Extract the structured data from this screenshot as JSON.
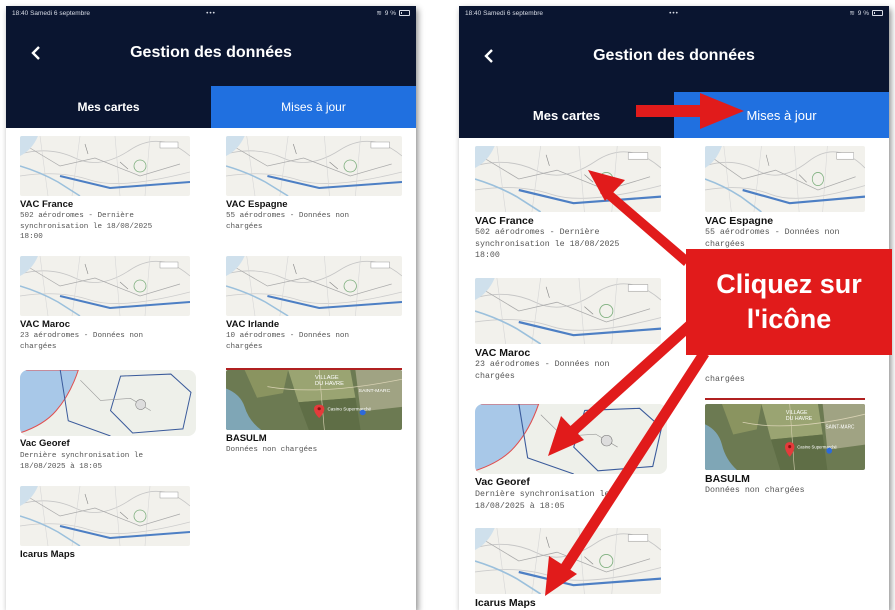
{
  "status": {
    "time_date": "18:40  Samedi 6 septembre",
    "battery": "9 %"
  },
  "header": {
    "title": "Gestion des données"
  },
  "tabs": [
    {
      "label": "Mes cartes",
      "active": false
    },
    {
      "label": "Mises à jour",
      "active": true
    }
  ],
  "cards": [
    {
      "name": "VAC France",
      "desc": "502 aérodromes - Dernière\nsynchronisation le 18/08/2025\n18:00",
      "thumb": "chart"
    },
    {
      "name": "VAC Espagne",
      "desc": "55 aérodromes - Données non\nchargées",
      "thumb": "chart"
    },
    {
      "name": "VAC Maroc",
      "desc": "23 aérodromes - Données non\nchargées",
      "thumb": "chart"
    },
    {
      "name": "VAC Irlande",
      "desc": "10 aérodromes - Données non\nchargées",
      "thumb": "chart"
    },
    {
      "name": "Vac Georef",
      "desc": "Dernière synchronisation le\n18/08/2025 à 18:05",
      "thumb": "georef"
    },
    {
      "name": "BASULM",
      "desc": "Données non chargées",
      "thumb": "satellite"
    },
    {
      "name": "Icarus Maps",
      "desc": "",
      "thumb": "chart"
    }
  ],
  "right_partial_desc": "chargées",
  "callout": {
    "line1": "Cliquez sur",
    "line2": "l'icône"
  },
  "satellite_labels": {
    "village": "VILLAGE\nDU HAVRE",
    "marc": "SAINT-MARC",
    "casino": "Casino Supermarché"
  },
  "colors": {
    "navy": "#0a1530",
    "tab_active": "#2070e0",
    "annotation_red": "#e11b1b"
  }
}
